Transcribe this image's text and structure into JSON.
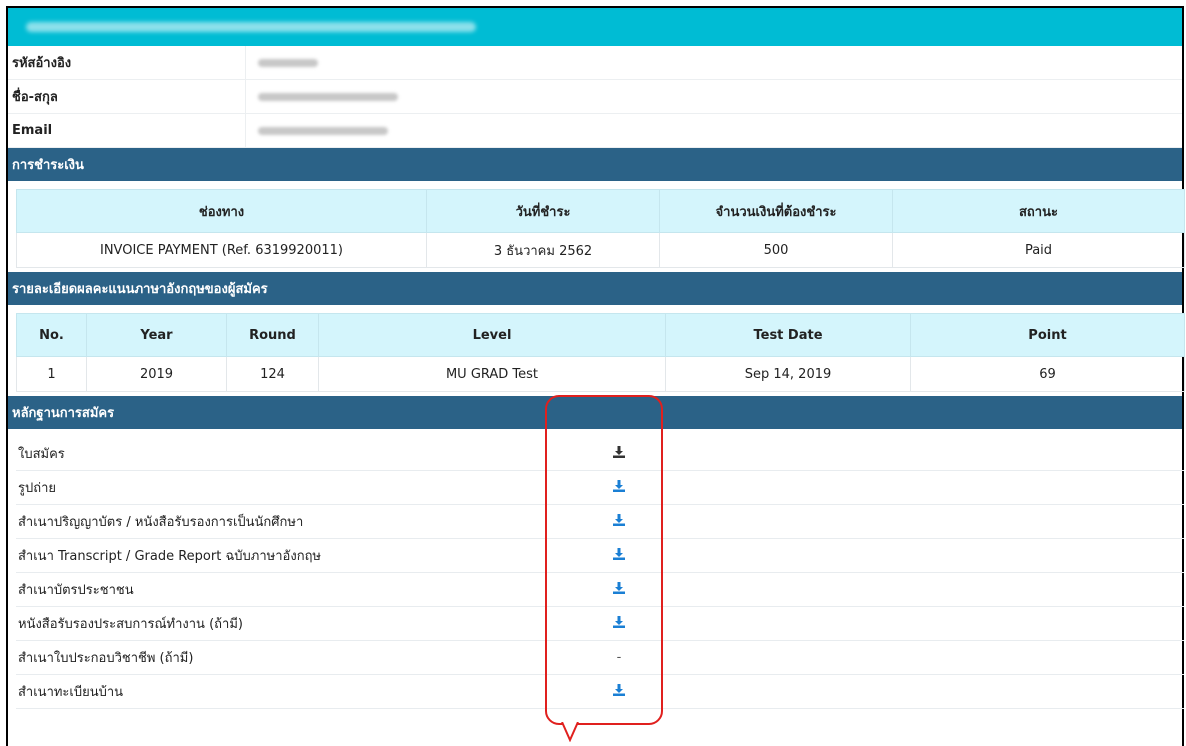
{
  "applicant": {
    "rows": [
      {
        "label": "รหัสอ้างอิง"
      },
      {
        "label": "ชื่อ-สกุล"
      },
      {
        "label": "Email"
      }
    ]
  },
  "payment": {
    "section_title": "การชำระเงิน",
    "headers": [
      "ช่องทาง",
      "วันที่ชำระ",
      "จำนวนเงินที่ต้องชำระ",
      "สถานะ"
    ],
    "row": [
      "INVOICE PAYMENT (Ref. 6319920011)",
      "3 ธันวาคม 2562",
      "500",
      "Paid"
    ]
  },
  "scores": {
    "section_title": "รายละเอียดผลคะแนนภาษาอังกฤษของผู้สมัคร",
    "headers": [
      "No.",
      "Year",
      "Round",
      "Level",
      "Test Date",
      "Point"
    ],
    "row": [
      "1",
      "2019",
      "124",
      "MU GRAD Test",
      "Sep 14, 2019",
      "69"
    ]
  },
  "documents": {
    "section_title": "หลักฐานการสมัคร",
    "items": [
      {
        "label": "ใบสมัคร",
        "action": "download-icon",
        "icon_color": "#333333"
      },
      {
        "label": "รูปถ่าย",
        "action": "download-icon",
        "icon_color": "#1a7fd4"
      },
      {
        "label": "สำเนาปริญญาบัตร / หนังสือรับรองการเป็นนักศึกษา",
        "action": "download-icon",
        "icon_color": "#1a7fd4"
      },
      {
        "label": "สำเนา Transcript / Grade Report ฉบับภาษาอังกฤษ",
        "action": "download-icon",
        "icon_color": "#1a7fd4"
      },
      {
        "label": "สำเนาบัตรประชาชน",
        "action": "download-icon",
        "icon_color": "#1a7fd4"
      },
      {
        "label": "หนังสือรับรองประสบการณ์ทำงาน (ถ้ามี)",
        "action": "download-icon",
        "icon_color": "#1a7fd4"
      },
      {
        "label": "สำเนาใบประกอบวิชาชีพ (ถ้ามี)",
        "action": "-",
        "icon_color": ""
      },
      {
        "label": "สำเนาทะเบียนบ้าน",
        "action": "download-icon",
        "icon_color": "#1a7fd4"
      }
    ]
  },
  "colors": {
    "top_bar": "#00bcd4",
    "section_header": "#2b6287",
    "table_header": "#d4f5fc",
    "callout": "#e0201e"
  }
}
